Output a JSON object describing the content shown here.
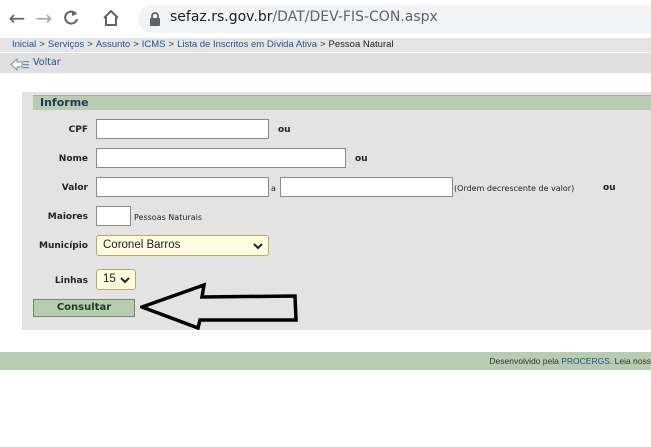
{
  "browser": {
    "url_host": "sefaz.rs.gov.br",
    "url_path": "/DAT/DEV-FIS-CON.aspx",
    "icons": [
      "back-arrow-icon",
      "forward-arrow-icon",
      "reload-icon",
      "home-icon",
      "lock-icon"
    ]
  },
  "breadcrumb": {
    "items": [
      "Inicial",
      "Serviços",
      "Assunto",
      "ICMS",
      "Lista de Inscritos em Dívida Ativa"
    ],
    "current": "Pessoa Natural",
    "separator": ">"
  },
  "voltar": {
    "label": "Voltar"
  },
  "form": {
    "title": "Informe",
    "cpf": {
      "label": "CPF",
      "value": "",
      "suffix": "ou"
    },
    "nome": {
      "label": "Nome",
      "value": "",
      "suffix": "ou"
    },
    "valor": {
      "label": "Valor",
      "from": "",
      "connector": "a",
      "to": "",
      "note": "(Ordem decrescente de valor)",
      "suffix": "ou"
    },
    "maiores": {
      "label": "Maiores",
      "value": "",
      "suffix": "Pessoas Naturais"
    },
    "municipio": {
      "label": "Município",
      "selected": "Coronel Barros"
    },
    "linhas": {
      "label": "Linhas",
      "selected": "15"
    },
    "submit_label": "Consultar"
  },
  "footer": {
    "prefix": "Desenvolvido pela ",
    "link": "PROCERGS.",
    "suffix": " Leia noss"
  },
  "colors": {
    "header_green": "#b7ccb1",
    "panel_gray": "#e3e3e3",
    "select_bg": "#fffde0",
    "link_blue": "#2a4d8f"
  }
}
